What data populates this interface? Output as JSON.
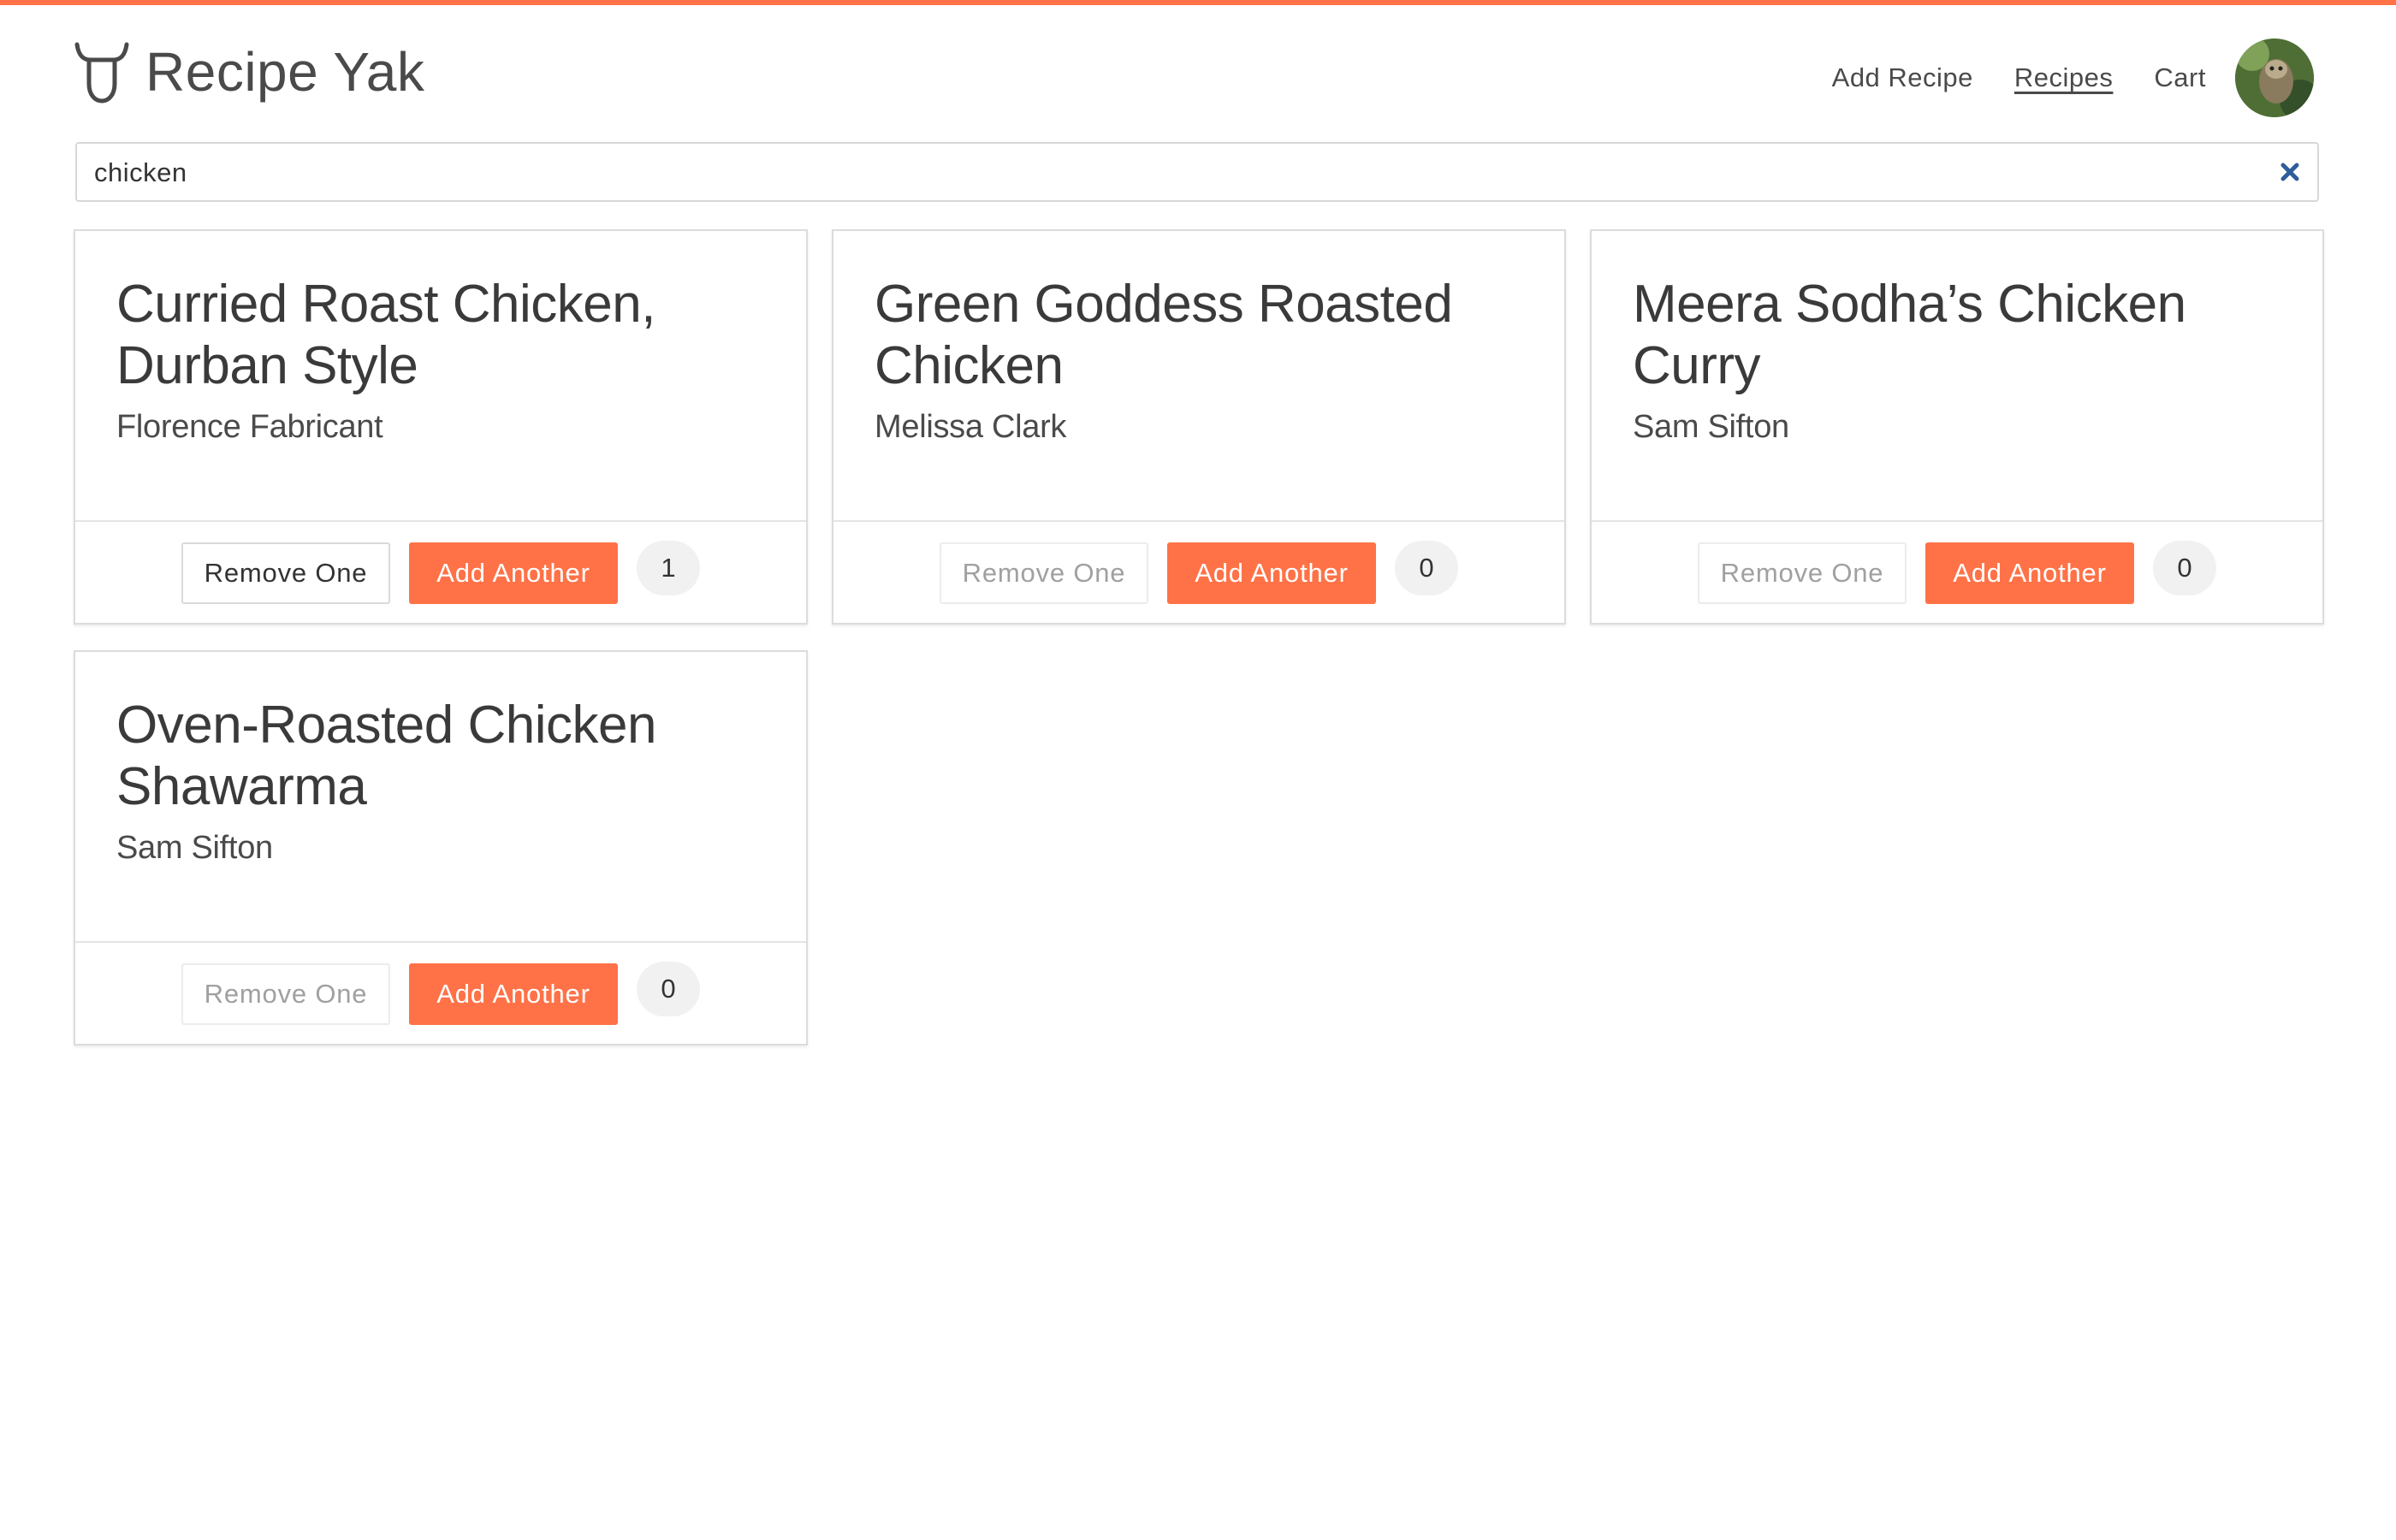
{
  "app": {
    "name": "Recipe Yak",
    "accent_color": "#ff7247"
  },
  "nav": {
    "add_recipe": "Add Recipe",
    "recipes": "Recipes",
    "cart": "Cart",
    "avatar_icon": "user-avatar"
  },
  "search": {
    "value": "chicken",
    "clear_icon": "close-icon"
  },
  "recipes": [
    {
      "title": "Curried Roast Chicken, Durban Style",
      "author": "Florence Fabricant",
      "remove_label": "Remove One",
      "add_label": "Add Another",
      "count": "1",
      "remove_enabled": true
    },
    {
      "title": "Green Goddess Roasted Chicken",
      "author": "Melissa Clark",
      "remove_label": "Remove One",
      "add_label": "Add Another",
      "count": "0",
      "remove_enabled": false
    },
    {
      "title": "Meera Sodha’s Chicken Curry",
      "author": "Sam Sifton",
      "remove_label": "Remove One",
      "add_label": "Add Another",
      "count": "0",
      "remove_enabled": false
    },
    {
      "title": "Oven-Roasted Chicken Shawarma",
      "author": "Sam Sifton",
      "remove_label": "Remove One",
      "add_label": "Add Another",
      "count": "0",
      "remove_enabled": false
    }
  ]
}
